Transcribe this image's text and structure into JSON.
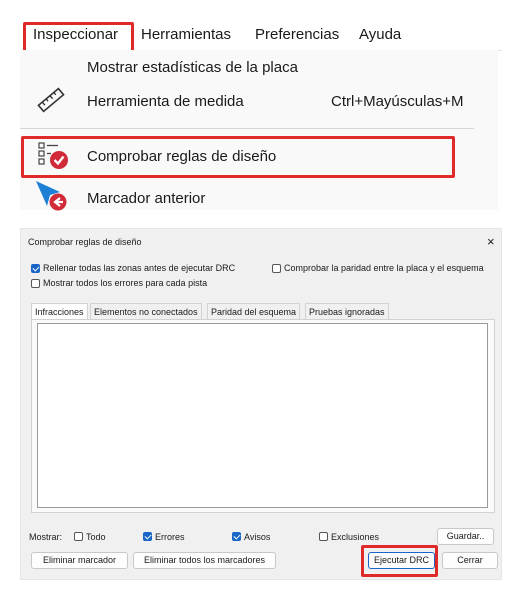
{
  "menubar": {
    "items": [
      "Inspeccionar",
      "Herramientas",
      "Preferencias",
      "Ayuda"
    ]
  },
  "dropdown": {
    "items": [
      {
        "label": "Mostrar estadísticas de la placa",
        "shortcut": ""
      },
      {
        "label": "Herramienta de medida",
        "shortcut": "Ctrl+Mayúsculas+M"
      },
      {
        "label": "Comprobar reglas de diseño",
        "shortcut": ""
      },
      {
        "label": "Marcador anterior",
        "shortcut": ""
      }
    ]
  },
  "dialog": {
    "title": "Comprobar reglas de diseño",
    "close_glyph": "×",
    "options": [
      {
        "label": "Rellenar todas las zonas antes de ejecutar DRC",
        "checked": true
      },
      {
        "label": "Comprobar la paridad entre la placa y el esquema",
        "checked": false
      },
      {
        "label": "Mostrar todos los errores para cada pista",
        "checked": false
      }
    ],
    "tabs": [
      "Infracciones",
      "Elementos no conectados",
      "Paridad del esquema",
      "Pruebas ignoradas"
    ],
    "show_label": "Mostrar:",
    "filters": [
      {
        "label": "Todo",
        "checked": false
      },
      {
        "label": "Errores",
        "checked": true
      },
      {
        "label": "Avisos",
        "checked": true
      },
      {
        "label": "Exclusiones",
        "checked": false
      }
    ],
    "buttons": {
      "save": "Guardar..",
      "delete_marker": "Eliminar marcador",
      "delete_all_markers": "Eliminar todos los marcadores",
      "run_drc": "Ejecutar DRC",
      "close": "Cerrar"
    }
  },
  "colors": {
    "highlight": "#e02a2a",
    "check_accent": "#1a66c8",
    "drc_icon_red": "#d12b3a",
    "cursor_blue": "#1e7fd6"
  }
}
